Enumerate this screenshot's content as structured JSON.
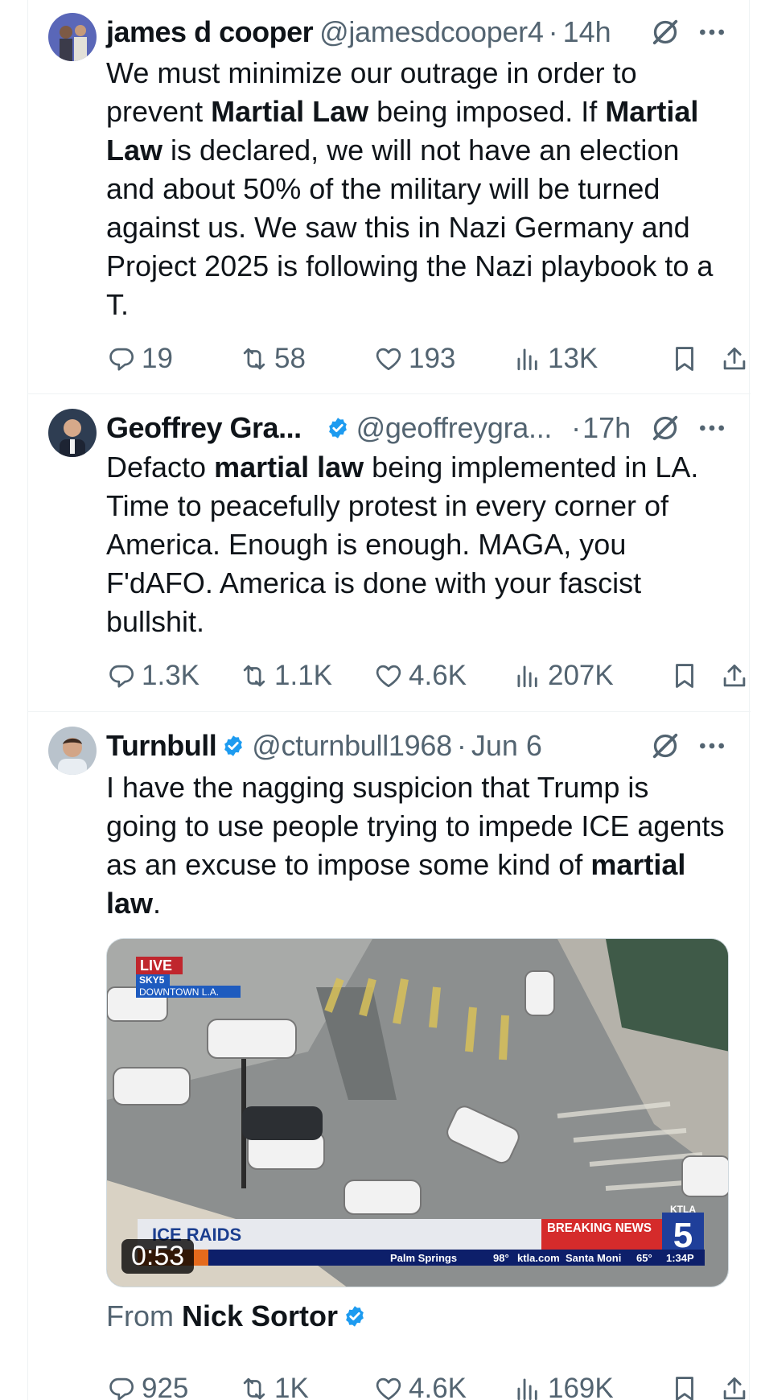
{
  "tweets": [
    {
      "name": "james d cooper",
      "handle": "@jamesdcooper4",
      "time": "14h",
      "verified": false,
      "body": [
        {
          "t": "We must minimize our outrage in order to prevent "
        },
        {
          "t": "Martial Law",
          "b": true
        },
        {
          "t": " being imposed. If "
        },
        {
          "t": "Martial Law",
          "b": true
        },
        {
          "t": " is declared, we will not have an election and about 50% of the military will be turned against us. We saw this in Nazi Germany and Project 2025 is following the Nazi playbook to a T."
        }
      ],
      "stats": {
        "replies": "19",
        "reposts": "58",
        "likes": "193",
        "views": "13K"
      }
    },
    {
      "name": "Geoffrey Gra...",
      "handle": "@geoffreygra...",
      "time": "17h",
      "verified": true,
      "body": [
        {
          "t": "Defacto "
        },
        {
          "t": "martial law",
          "b": true
        },
        {
          "t": " being implemented in LA. Time to peacefully protest in every corner of America.  Enough is enough. MAGA, you F'dAFO. America is done with your fascist bullshit."
        }
      ],
      "stats": {
        "replies": "1.3K",
        "reposts": "1.1K",
        "likes": "4.6K",
        "views": "207K"
      }
    },
    {
      "name": "Turnbull",
      "handle": "@cturnbull1968",
      "time": "Jun 6",
      "verified": true,
      "body": [
        {
          "t": "I have the nagging suspicion that Trump is going to use people trying to impede ICE agents as an excuse to impose some kind of "
        },
        {
          "t": "martial law",
          "b": true
        },
        {
          "t": "."
        }
      ],
      "media": {
        "live_label": "LIVE",
        "sky_label": "SKY5",
        "location_label": "DOWNTOWN L.A.",
        "ticker_headline": "ICE RAIDS",
        "breaking_label": "BREAKING NEWS",
        "station_label": "KTLA",
        "channel_number": "5",
        "ticker_items": [
          "Palm Springs",
          "98°",
          "ktla.com",
          "Santa Moni",
          "65°",
          "1:34P"
        ],
        "duration": "0:53"
      },
      "from_prefix": "From",
      "from_name": "Nick Sortor",
      "stats": {
        "replies": "925",
        "reposts": "1K",
        "likes": "4.6K",
        "views": "169K"
      }
    }
  ],
  "colors": {
    "verified": "#1d9bf0",
    "text": "#0f1419",
    "muted": "#536471",
    "divider": "#eff3f4"
  },
  "icons": [
    "reply-icon",
    "repost-icon",
    "like-icon",
    "views-icon",
    "bookmark-icon",
    "share-icon",
    "grok-icon",
    "more-icon",
    "verified-badge-icon"
  ]
}
